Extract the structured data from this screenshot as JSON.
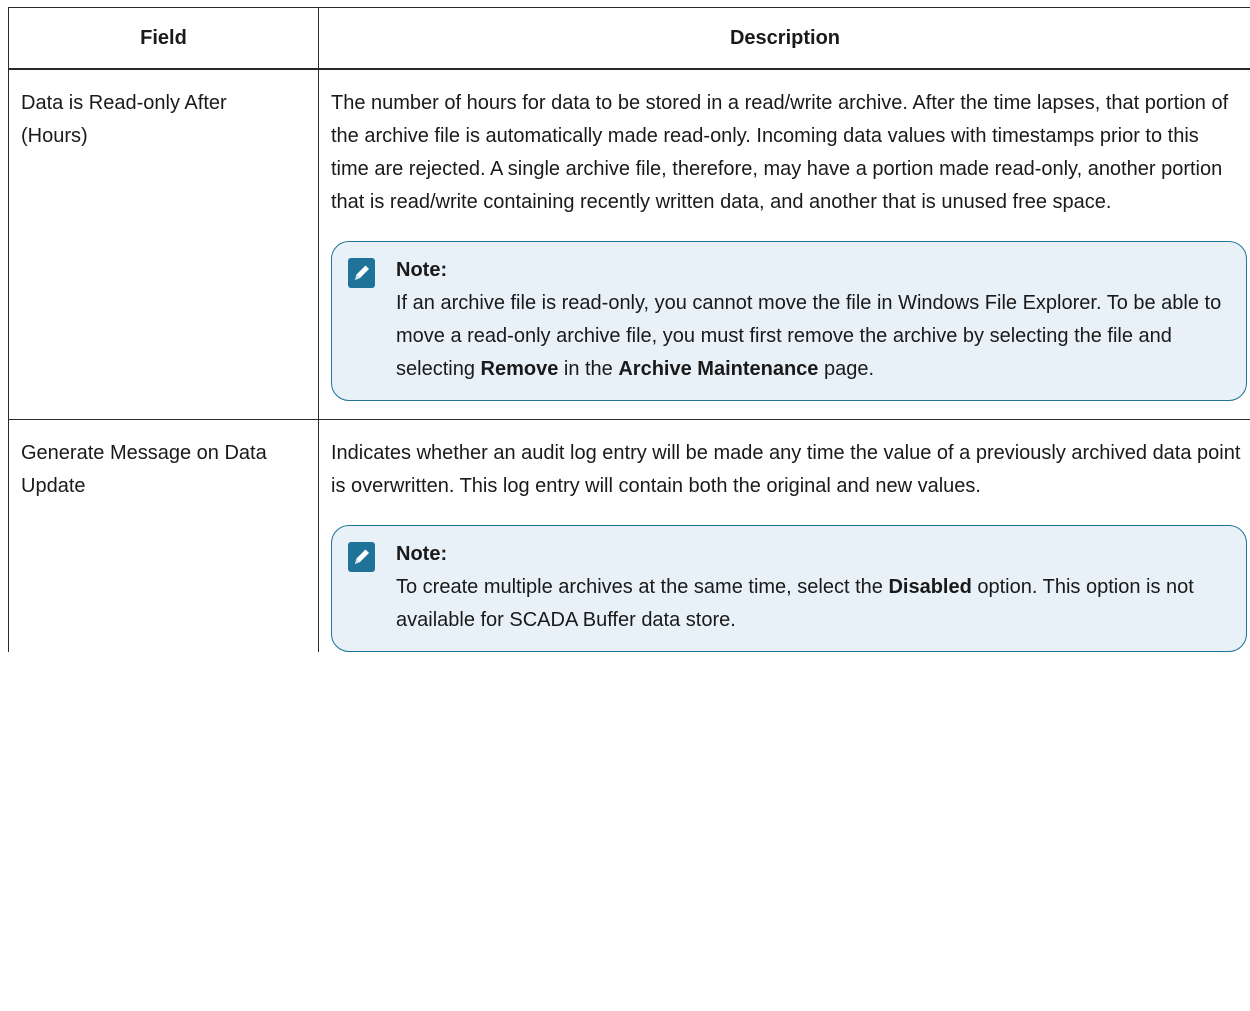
{
  "table": {
    "headers": {
      "field": "Field",
      "description": "Description"
    },
    "rows": [
      {
        "field": "Data is Read-only After (Hours)",
        "description": "The number of hours for data to be stored in a read/write archive. After the time lapses, that portion of the archive file is automatically made read-only. Incoming data values with timestamps prior to this time are rejected. A single archive file, therefore, may have a portion made read-only, another portion that is read/write containing recently written data, and another that is unused free space.",
        "note": {
          "title": "Note:",
          "text_1": "If an archive file is read-only, you cannot move the file in Windows File Explorer. To be able to move a read-only archive file, you must first remove the archive by selecting the file and selecting ",
          "bold_1": "Remove",
          "text_2": " in the ",
          "bold_2": "Archive Maintenance",
          "text_3": " page."
        }
      },
      {
        "field": "Generate Message on Data Update",
        "description": "Indicates whether an audit log entry will be made any time the value of a previously archived data point is overwritten. This log entry will contain both the original and new values.",
        "note": {
          "title": "Note:",
          "text_1": "To create multiple archives at the same time, select the ",
          "bold_1": "Disabled",
          "text_2": " option. This option is not available for SCADA Buffer data store."
        }
      }
    ]
  },
  "colors": {
    "note_bg": "#e7f1f7",
    "note_border": "#1f7399",
    "icon": "#1f7399"
  },
  "icons": {
    "note": "pencil-clipboard-icon"
  }
}
